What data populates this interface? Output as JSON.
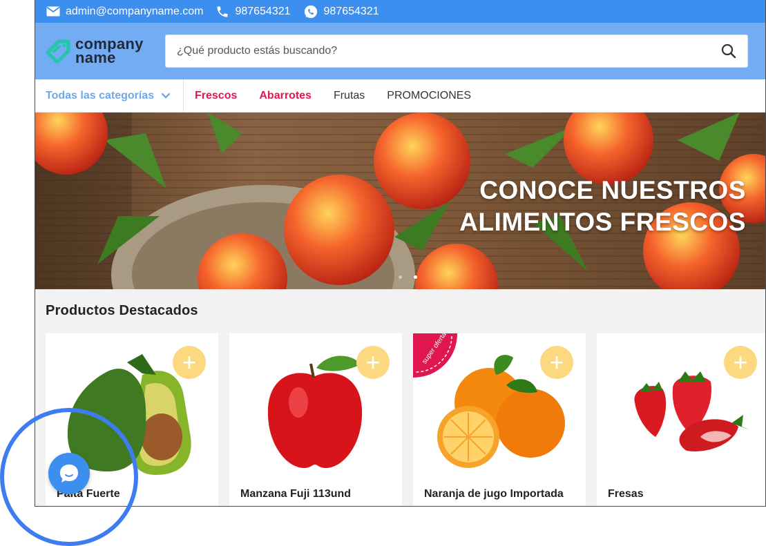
{
  "topbar": {
    "email": "admin@companyname.com",
    "phone": "987654321",
    "whatsapp": "987654321",
    "icons": [
      "mail-icon",
      "phone-icon",
      "whatsapp-icon"
    ]
  },
  "header": {
    "logo_line1": "company",
    "logo_line2": "name",
    "search_placeholder": "¿Qué producto estás buscando?"
  },
  "nav": {
    "categories_label": "Todas las categorías",
    "links": [
      "Frescos",
      "Abarrotes",
      "Frutas",
      "PROMOCIONES"
    ]
  },
  "banner": {
    "line1": "CONOCE NUESTROS",
    "line2": "ALIMENTOS FRESCOS",
    "slides": 2,
    "active_slide": 2
  },
  "featured": {
    "title": "Productos Destacados",
    "products": [
      {
        "name": "Palta Fuerte",
        "add_label": "+"
      },
      {
        "name": "Manzana Fuji 113und",
        "add_label": "+"
      },
      {
        "name": "Naranja de jugo Importada",
        "add_label": "+",
        "badge": "super oferta"
      },
      {
        "name": "Fresas",
        "add_label": "+"
      }
    ]
  },
  "colors": {
    "topbar": "#3d8fef",
    "header": "#74acf3",
    "accent_red": "#e0174f",
    "add_button": "#fcd981",
    "chat": "#3d8fef"
  }
}
